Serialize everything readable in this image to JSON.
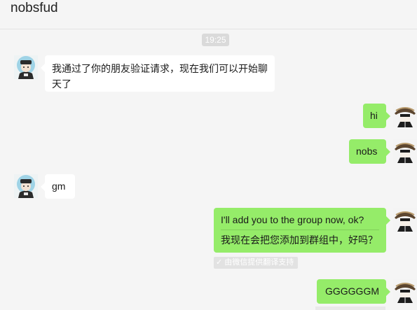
{
  "header": {
    "title": "nobsfud"
  },
  "chat": {
    "time_badge": "19:25",
    "messages": [
      {
        "from": "contact",
        "text": "我通过了你的朋友验证请求，现在我们可以开始聊天了"
      },
      {
        "from": "self",
        "text": "hi"
      },
      {
        "from": "self",
        "text": "nobs"
      },
      {
        "from": "contact",
        "text": "gm"
      },
      {
        "from": "self",
        "text": "I'll add you to the group now, ok?",
        "translation": "我现在会把您添加到群组中，好吗？"
      },
      {
        "from": "self",
        "text": "GGGGGGM"
      }
    ],
    "translation_note": "由微信提供翻译支持",
    "translation_check_icon": "check-icon"
  },
  "avatars": {
    "contact": "contact-avatar",
    "self": "self-avatar"
  },
  "colors": {
    "background": "#f5f5f5",
    "incoming_bubble": "#ffffff",
    "outgoing_bubble": "#95ec69",
    "time_badge": "#dadada"
  }
}
